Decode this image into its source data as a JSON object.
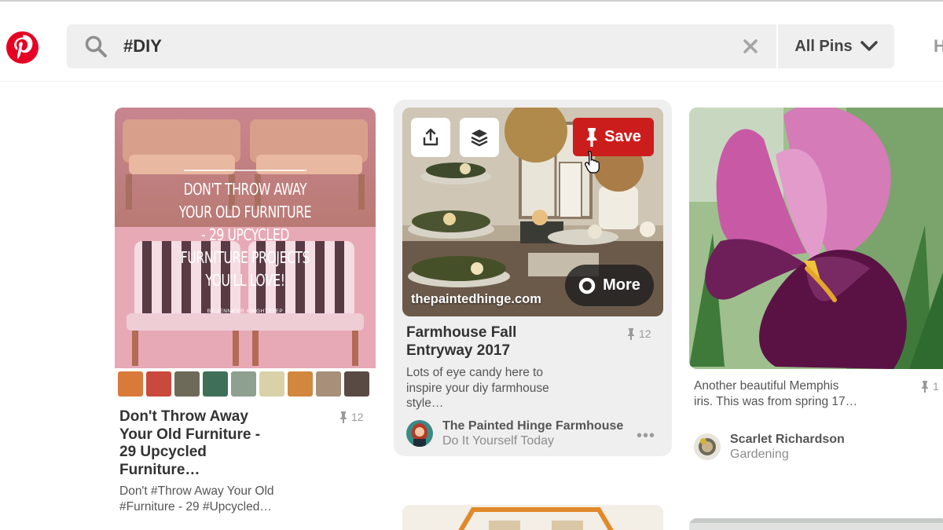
{
  "search": {
    "query": "#DIY"
  },
  "filter": {
    "label": "All Pins"
  },
  "nav": {
    "partial_label": "H"
  },
  "pins": [
    {
      "title": "Don't Throw Away Your Old Furniture - 29 Upcycled Furniture…",
      "description": "Don't #Throw Away Your Old #Furniture - 29 #Upcycled…",
      "save_count": "12",
      "overlay_text": "DON'T THROW AWAY YOUR OLD FURNITURE - 29 UPCYCLED FURNITURE PROJECTS YOU'LL LOVE!",
      "overlay_byline": "BY JENNIFER KNIGHTSTEP"
    },
    {
      "title": "Farmhouse Fall Entryway 2017",
      "description": "Lots of eye candy here to inspire your diy farmhouse style…",
      "save_count": "12",
      "domain": "thepaintedhinge.com",
      "save_label": "Save",
      "more_label": "More",
      "author": "The Painted Hinge Farmhouse",
      "board": "Do It Yourself Today"
    },
    {
      "description": "Another beautiful Memphis iris. This was from spring 17…",
      "save_count": "1",
      "author": "Scarlet Richardson",
      "board": "Gardening"
    }
  ],
  "colors": {
    "brand": "#e60023",
    "save_red": "#cc1d1d",
    "hover_bg": "#efefef"
  },
  "icons": [
    "pinterest-logo",
    "search-icon",
    "clear-icon",
    "chevron-down-icon",
    "share-icon",
    "layers-icon",
    "pin-icon",
    "more-circle-icon",
    "ellipsis-icon",
    "hand-cursor"
  ]
}
